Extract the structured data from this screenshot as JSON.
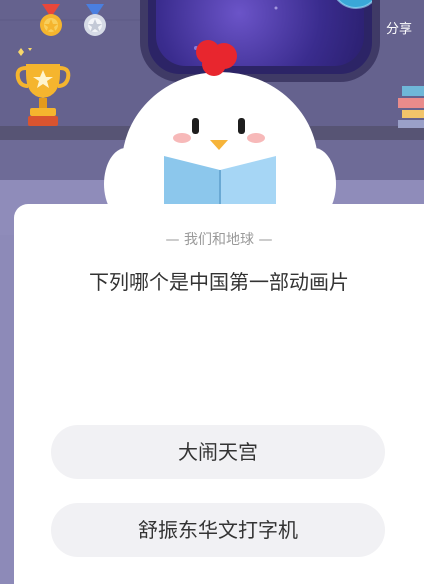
{
  "header": {
    "share_label": "分享"
  },
  "quiz": {
    "category": "— 我们和地球 —",
    "question": "下列哪个是中国第一部动画片",
    "options": [
      {
        "label": "大闹天宫"
      },
      {
        "label": "舒振东华文打字机"
      }
    ]
  },
  "scene": {
    "icons": [
      "gold-medal-icon",
      "silver-medal-icon",
      "trophy-icon",
      "books-icon",
      "earth-globe-icon",
      "chick-mascot"
    ],
    "colors": {
      "wall": "#6a6794",
      "window": "#2c2466",
      "card": "#ffffff",
      "option_bg": "#f1f1f4",
      "text": "#333333",
      "muted_text": "#9a9a9a"
    }
  }
}
